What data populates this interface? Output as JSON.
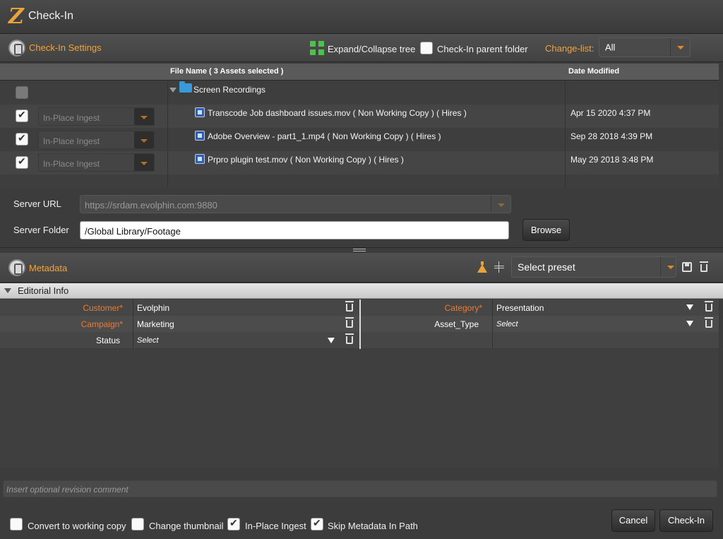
{
  "window": {
    "title": "Check-In",
    "logo_letter": "Z"
  },
  "settings": {
    "section_title": "Check-In Settings",
    "expand_label": "Expand/Collapse tree",
    "parent_folder_label": "Check-In parent folder",
    "changelist_label": "Change-list:",
    "changelist_value": "All"
  },
  "table": {
    "col_filename": "File Name  ( 3 Assets selected )",
    "col_date": "Date Modified",
    "folder_name": "Screen Recordings",
    "rows": [
      {
        "ingest": "In-Place Ingest",
        "name": "Transcode Job dashboard issues.mov ( Non Working Copy ) ( Hires )",
        "date": "Apr 15 2020 4:37 PM"
      },
      {
        "ingest": "In-Place Ingest",
        "name": "Adobe Overview - part1_1.mp4 ( Non Working Copy ) ( Hires )",
        "date": "Sep 28 2018 4:39 PM"
      },
      {
        "ingest": "In-Place Ingest",
        "name": "Prpro plugin test.mov ( Non Working Copy ) ( Hires )",
        "date": "May 29 2018 3:48 PM"
      }
    ]
  },
  "server": {
    "url_label": "Server URL",
    "url_value": "https://srdam.evolphin.com:9880",
    "folder_label": "Server Folder",
    "folder_value": "/Global Library/Footage",
    "browse_label": "Browse"
  },
  "metadata": {
    "section_title": "Metadata",
    "preset_placeholder": "Select preset",
    "group_title": "Editorial Info",
    "fields": {
      "customer_label": "Customer*",
      "customer_value": "Evolphin",
      "campaign_label": "Campaign*",
      "campaign_value": "Marketing",
      "status_label": "Status",
      "status_value": "Select",
      "category_label": "Category*",
      "category_value": "Presentation",
      "asset_type_label": "Asset_Type",
      "asset_type_value": "Select"
    }
  },
  "footer": {
    "comment_placeholder": "Insert optional revision comment",
    "convert_label": "Convert to working copy",
    "thumbnail_label": "Change thumbnail",
    "inplace_label": "In-Place Ingest",
    "skip_label": "Skip Metadata In Path",
    "cancel_label": "Cancel",
    "checkin_label": "Check-In"
  },
  "colors": {
    "accent": "#f2a33a",
    "required": "#f07a2a"
  }
}
